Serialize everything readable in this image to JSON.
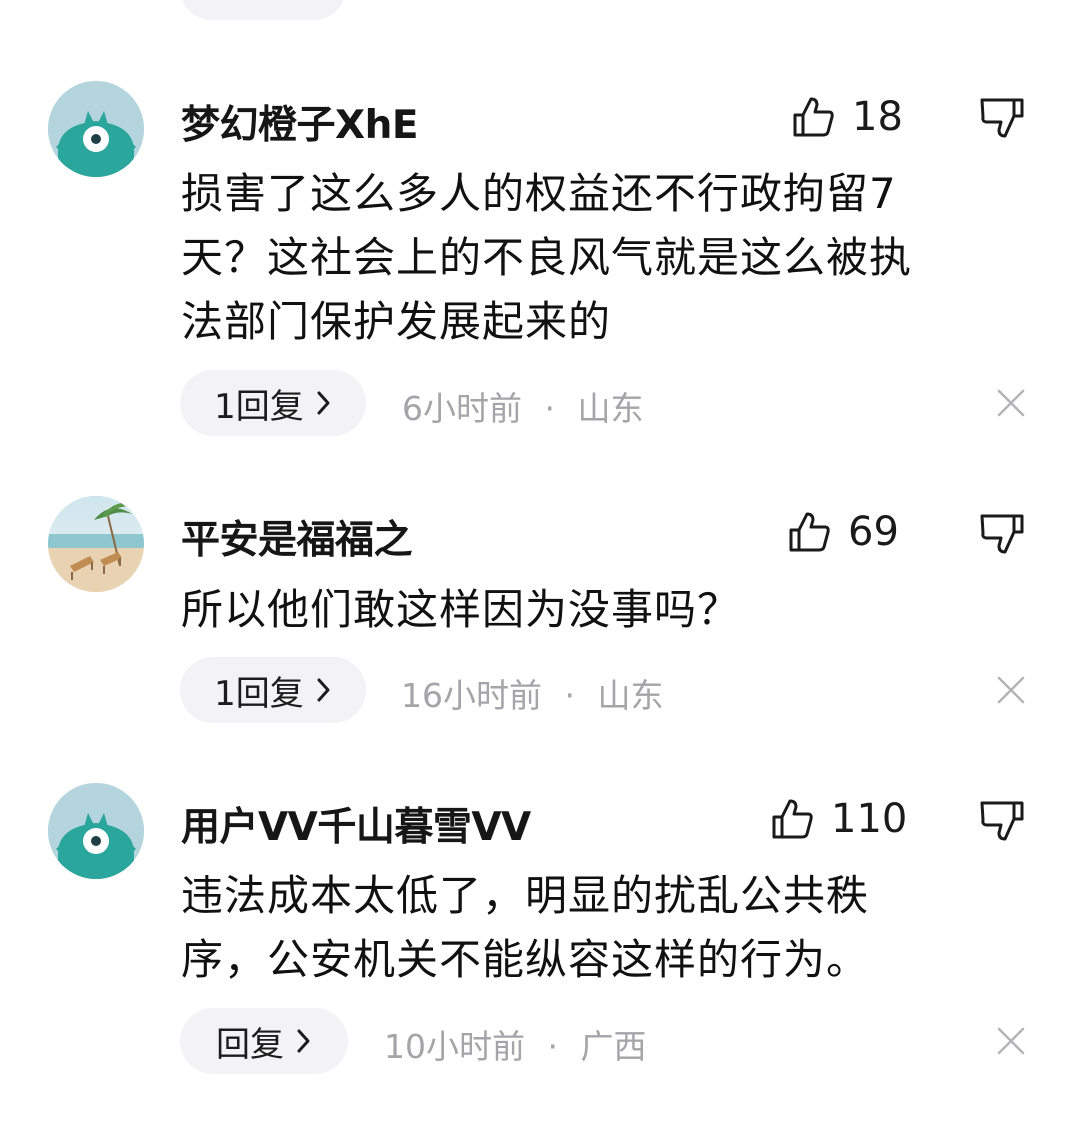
{
  "comments": [
    {
      "username": "梦幻橙子XhE",
      "likes": "18",
      "text_lines": [
        "损害了这么多人的权益还不行政拘留7",
        "天？这社会上的不良风气就是这么被执",
        "法部门保护发展起来的"
      ],
      "reply_label": "1回复",
      "time": "6小时前",
      "location": "山东",
      "avatar": "default-mascot"
    },
    {
      "username": "平安是福福之",
      "likes": "69",
      "text_lines": [
        "所以他们敢这样因为没事吗？"
      ],
      "reply_label": "1回复",
      "time": "16小时前",
      "location": "山东",
      "avatar": "beach-photo"
    },
    {
      "username": "用户VV千山暮雪VV",
      "likes": "110",
      "text_lines": [
        "违法成本太低了，明显的扰乱公共秩",
        "序，公安机关不能纵容这样的行为。"
      ],
      "reply_label": "回复",
      "time": "10小时前",
      "location": "广西",
      "avatar": "default-mascot"
    }
  ],
  "separator": "·",
  "icons": {
    "like": "thumbs-up-icon",
    "dislike": "thumbs-down-icon",
    "close": "close-icon",
    "chevron": "chevron-right-icon"
  },
  "colors": {
    "background": "#ffffff",
    "pill_bg": "#f3f3f5",
    "meta_text": "#a4a4a9",
    "avatar_mascot": "#2aa69c"
  }
}
